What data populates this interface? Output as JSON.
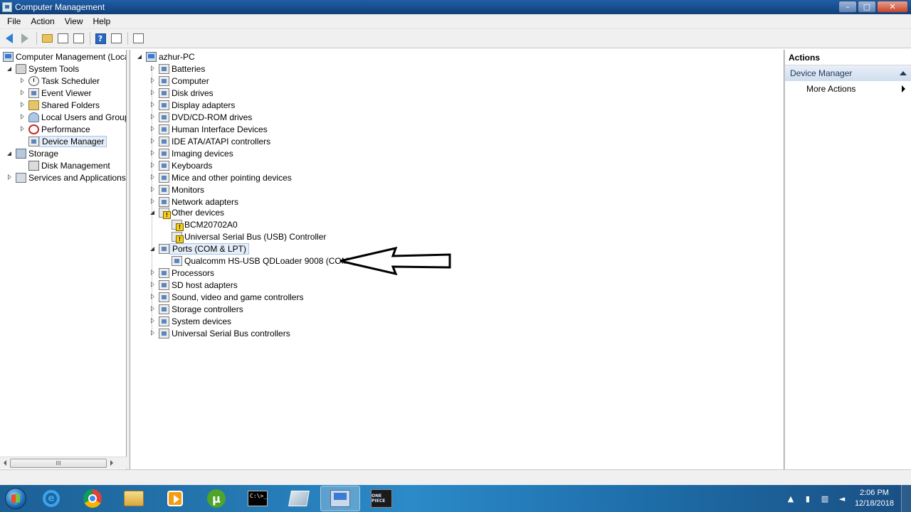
{
  "window": {
    "title": "Computer Management",
    "controls": [
      "–",
      "□",
      "✕"
    ]
  },
  "menu": [
    "File",
    "Action",
    "View",
    "Help"
  ],
  "toolbar": {
    "help_glyph": "?"
  },
  "left_tree": {
    "root": "Computer Management (Local",
    "system_tools": "System Tools",
    "items": [
      "Task Scheduler",
      "Event Viewer",
      "Shared Folders",
      "Local Users and Groups",
      "Performance",
      "Device Manager"
    ],
    "storage": "Storage",
    "disk_management": "Disk Management",
    "services": "Services and Applications",
    "scroll_thumb": "III"
  },
  "device_tree": {
    "root": "azhur-PC",
    "categories_top": [
      "Batteries",
      "Computer",
      "Disk drives",
      "Display adapters",
      "DVD/CD-ROM drives",
      "Human Interface Devices",
      "IDE ATA/ATAPI controllers",
      "Imaging devices",
      "Keyboards",
      "Mice and other pointing devices",
      "Monitors",
      "Network adapters"
    ],
    "other_devices": "Other devices",
    "other_children": [
      "BCM20702A0",
      "Universal Serial Bus (USB) Controller"
    ],
    "ports": "Ports (COM & LPT)",
    "ports_children": [
      "Qualcomm HS-USB QDLoader 9008 (COM6)"
    ],
    "categories_bottom": [
      "Processors",
      "SD host adapters",
      "Sound, video and game controllers",
      "Storage controllers",
      "System devices",
      "Universal Serial Bus controllers"
    ]
  },
  "actions": {
    "header": "Actions",
    "section": "Device Manager",
    "more": "More Actions"
  },
  "taskbar": {
    "ie_glyph": "e",
    "utorrent_glyph": "µ",
    "cmd_text": "C:\\>_",
    "game_text": "ONE PIECE",
    "time": "2:06 PM",
    "date": "12/18/2018"
  }
}
